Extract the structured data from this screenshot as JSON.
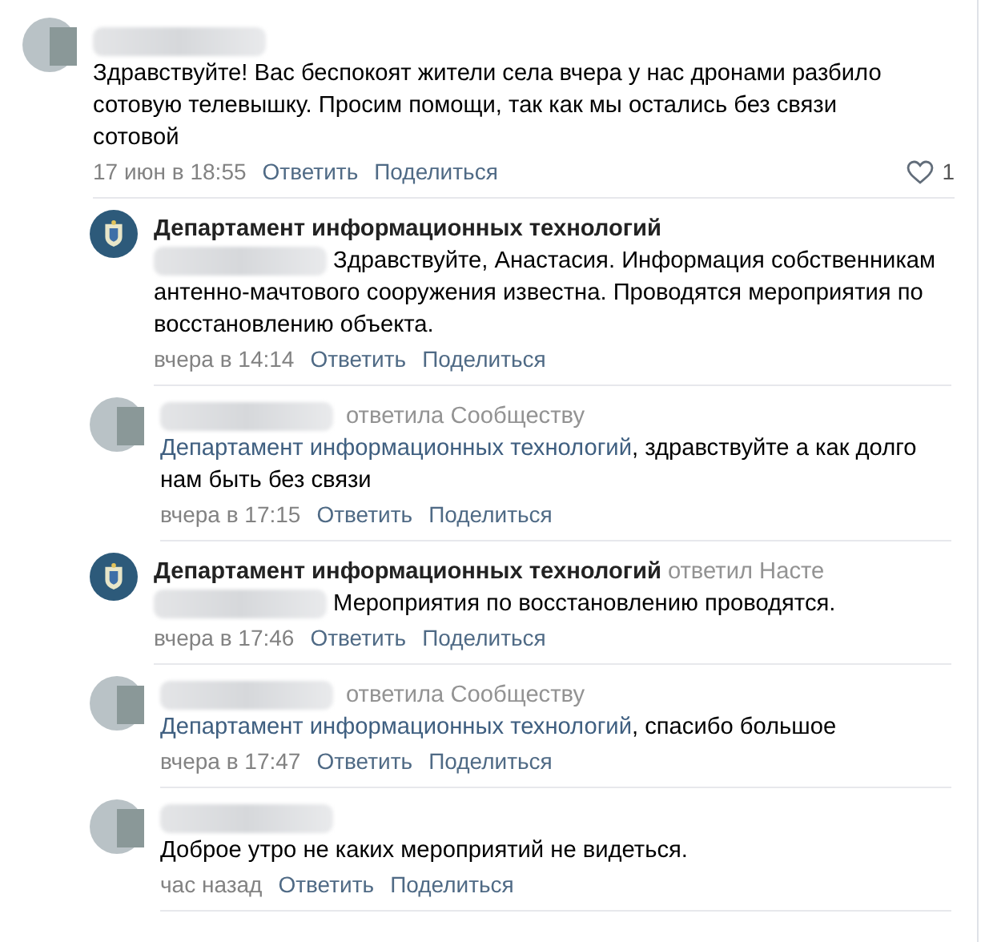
{
  "comment": {
    "kind": "user",
    "text": "Здравствуйте! Вас беспокоят жители села вчера у нас дронами разбило сотовую телевышку. Просим помощи, так как мы остались без связи сотовой",
    "time": "17 июн в 18:55",
    "actions": [
      "Ответить",
      "Поделиться"
    ],
    "likes": "1",
    "liked": false,
    "replies": [
      {
        "kind": "community",
        "author": "Департамент информационных технологий",
        "text": "Здравствуйте, Анастасия. Информация собственникам антенно-мачтового сооружения известна. Проводятся мероприятия по восстановлению объекта.",
        "time": "вчера в 14:14",
        "actions": [
          "Ответить",
          "Поделиться"
        ]
      },
      {
        "kind": "user",
        "reply_to": "ответила Сообществу",
        "mention": "Департамент информационных технологий",
        "text": ", здравствуйте а как долго нам быть без связи",
        "time": "вчера в 17:15",
        "actions": [
          "Ответить",
          "Поделиться"
        ]
      },
      {
        "kind": "community",
        "author": "Департамент информационных технологий",
        "reply_to": "ответил Насте",
        "text": "Мероприятия по восстановлению проводятся.",
        "time": "вчера в 17:46",
        "actions": [
          "Ответить",
          "Поделиться"
        ]
      },
      {
        "kind": "user",
        "reply_to": "ответила Сообществу",
        "mention": "Департамент информационных технологий",
        "text": ", спасибо большое",
        "time": "вчера в 17:47",
        "actions": [
          "Ответить",
          "Поделиться"
        ]
      },
      {
        "kind": "user",
        "text": "Доброе утро не каких мероприятий не видеться.",
        "time": "час назад",
        "actions": [
          "Ответить",
          "Поделиться"
        ]
      }
    ]
  }
}
